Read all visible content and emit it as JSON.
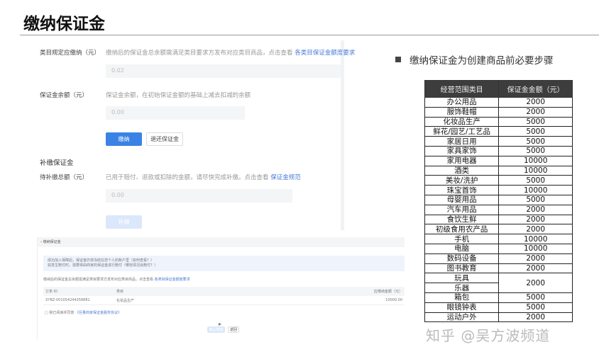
{
  "title": "缴纳保证金",
  "top_screenshot": {
    "required_label": "类目规定应缴纳（元）",
    "required_desc": "缴纳后的保证金总余额需满足类目要求方发布对应类目商品，点击查看",
    "required_link": "各类目保证金额度要求",
    "required_value": "0.02",
    "balance_label": "保证金余额（元）",
    "balance_desc": "保证金余额，在初始保证金额的基础上减去扣减的余额",
    "balance_value": "0.00",
    "pay_button": "缴纳",
    "refund_button": "退还保证金",
    "section_title": "补缴保证金",
    "pending_label": "待补缴总额（元）",
    "pending_desc": "已用于赔付、退款或扣除的金额，请尽快完成补缴。点击查看",
    "pending_link": "保证金规范",
    "pending_value": "0.00",
    "topup_button": "补缴"
  },
  "bottom_screenshot": {
    "header": "缴纳保证金",
    "notice_line1": "成功加入保障后，保证金仍将冻结在您个人的账户里（如何查看？）",
    "notice_line2": "如发生赔付时，需要将由商家的保证金进行赔付（哪些情况会赔付？）",
    "desc": "缴纳后的保证金总余额需满足类目要求方发布对应类目商品，点击查看",
    "desc_link": "各类目保证金额度要求",
    "col_order": "订单 ID",
    "col_category": "类目",
    "col_amount": "应缴纳金额（元）",
    "order_id": "XYBZ-V01054244258881",
    "category": "化妆品生产",
    "amount": "10000.00",
    "agree_text": "我已阅读并同意",
    "agree_link": "《巨量商家保证金服务协议》",
    "confirm_button": "确认缴纳",
    "back_button": "返回"
  },
  "bullet": "缴纳保证金为创建商品前必要步骤",
  "table": {
    "headers": [
      "经营范围类目",
      "保证金金额（元）"
    ],
    "rows": [
      [
        "办公用品",
        "2000"
      ],
      [
        "服饰鞋帽",
        "2000"
      ],
      [
        "化妆品生产",
        "5000"
      ],
      [
        "鲜花/园艺/工艺品",
        "5000"
      ],
      [
        "家居日用",
        "5000"
      ],
      [
        "家具家饰",
        "5000"
      ],
      [
        "家用电器",
        "10000"
      ],
      [
        "酒类",
        "10000"
      ],
      [
        "美妆/洗护",
        "5000"
      ],
      [
        "珠宝首饰",
        "10000"
      ],
      [
        "母婴用品",
        "5000"
      ],
      [
        "汽车用品",
        "2000"
      ],
      [
        "食饮生鲜",
        "2000"
      ],
      [
        "初级食用农产品",
        "2000"
      ],
      [
        "手机",
        "10000"
      ],
      [
        "电脑",
        "10000"
      ],
      [
        "数码设备",
        "2000"
      ],
      [
        "图书教育",
        "2000"
      ],
      [
        "玩具",
        "2000"
      ],
      [
        "乐器",
        ""
      ],
      [
        "箱包",
        "5000"
      ],
      [
        "眼镜钟表",
        "5000"
      ],
      [
        "运动户外",
        "2000"
      ]
    ]
  },
  "watermark": "知乎 @吴方波频道"
}
